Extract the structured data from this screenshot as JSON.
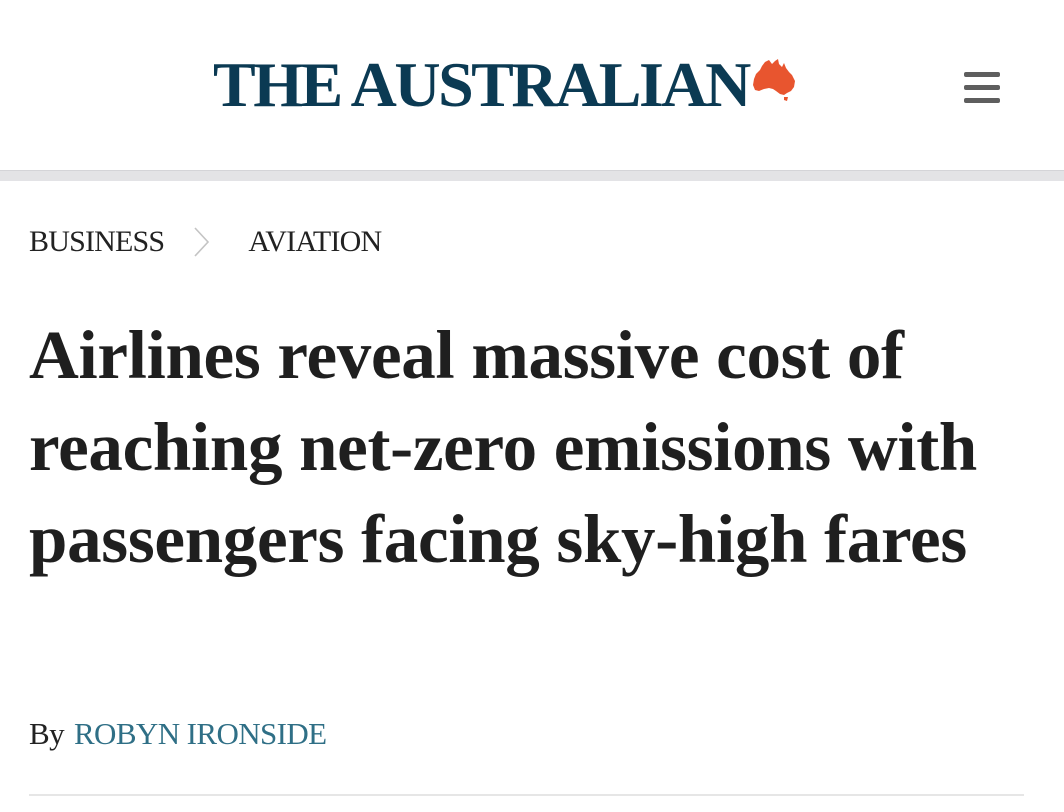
{
  "header": {
    "masthead_text": "THE AUSTRALIAN",
    "masthead_icon": "australia-map-icon",
    "masthead_icon_color": "#e8552f",
    "masthead_color": "#0b3a53",
    "menu_icon": "hamburger-menu-icon"
  },
  "breadcrumb": {
    "items": [
      {
        "label": "BUSINESS"
      },
      {
        "label": "AVIATION"
      }
    ],
    "separator_icon": "chevron-right-icon"
  },
  "article": {
    "headline": "Airlines reveal massive cost of reaching net-zero emissions with passengers facing sky-high fares",
    "byline_prefix": "By",
    "author": "ROBYN IRONSIDE",
    "author_color": "#2f6f86"
  }
}
